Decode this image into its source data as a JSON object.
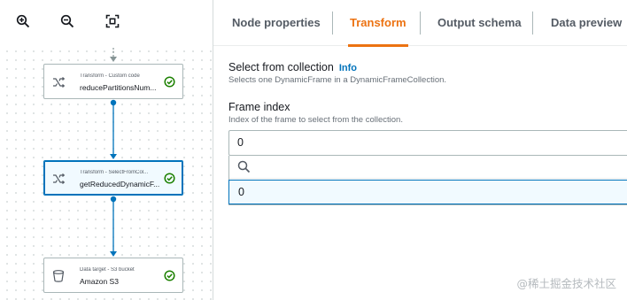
{
  "toolbar": {
    "zoom_in_icon": "zoom-in-icon",
    "zoom_out_icon": "zoom-out-icon",
    "fit_icon": "fit-to-screen-icon"
  },
  "nodes": [
    {
      "type": "Transform - Custom code",
      "name": "reducePartitionsNum...",
      "icon": "custom-code-transform-icon",
      "status": "success"
    },
    {
      "type": "Transform - SelectFromCol...",
      "name": "getReducedDynamicF...",
      "icon": "shuffle-transform-icon",
      "status": "success"
    },
    {
      "type": "Data target - S3 bucket",
      "name": "Amazon S3",
      "icon": "s3-bucket-icon",
      "status": "success"
    }
  ],
  "tabs": [
    {
      "label": "Node properties"
    },
    {
      "label": "Transform"
    },
    {
      "label": "Output schema"
    },
    {
      "label": "Data preview"
    }
  ],
  "active_tab": "Transform",
  "form": {
    "select_from_collection": {
      "label": "Select from collection",
      "info": "Info",
      "description": "Selects one DynamicFrame in a DynamicFrameCollection."
    },
    "frame_index": {
      "label": "Frame index",
      "description": "Index of the frame to select from the collection.",
      "value": "0",
      "search_placeholder": "",
      "options": [
        "0"
      ]
    }
  },
  "watermark": "@稀土掘金技术社区",
  "colors": {
    "accent": "#ec7211",
    "link": "#0073bb",
    "success": "#1d8102",
    "edge": "#0073bb"
  }
}
